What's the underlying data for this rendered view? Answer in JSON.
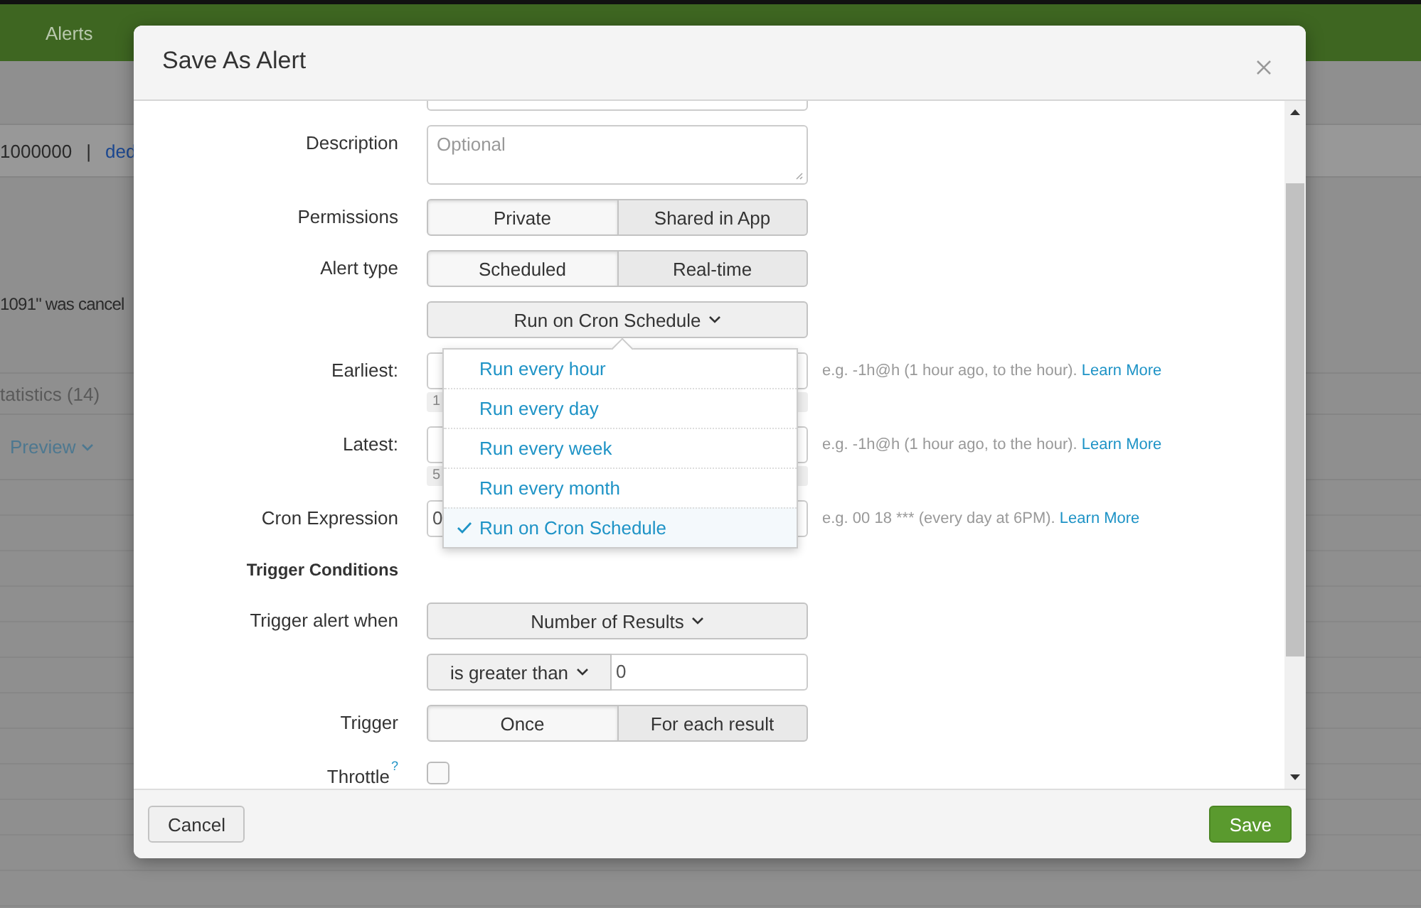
{
  "background": {
    "nav": [
      {
        "label": "Alerts"
      }
    ],
    "summary": {
      "count": "1000000",
      "separator": "|",
      "link": "ded"
    },
    "message": "1091\" was cancel",
    "tab": "tatistics (14)",
    "preview": "Preview"
  },
  "dialog": {
    "title": "Save As Alert",
    "rows": [
      {
        "kind": "textarea",
        "label": "Description",
        "placeholder": "Optional"
      },
      {
        "kind": "segmented",
        "label": "Permissions",
        "options": [
          {
            "label": "Private",
            "selected": true
          },
          {
            "label": "Shared in App",
            "selected": false
          }
        ]
      },
      {
        "kind": "segmented",
        "label": "Alert type",
        "options": [
          {
            "label": "Scheduled",
            "selected": true
          },
          {
            "label": "Real-time",
            "selected": false
          }
        ]
      },
      {
        "kind": "dropdown",
        "label": "",
        "value": "Run on Cron Schedule",
        "expanded": true,
        "options": [
          {
            "label": "Run every hour",
            "selected": false
          },
          {
            "label": "Run every day",
            "selected": false
          },
          {
            "label": "Run every week",
            "selected": false
          },
          {
            "label": "Run every month",
            "selected": false
          },
          {
            "label": "Run on Cron Schedule",
            "selected": true
          }
        ]
      },
      {
        "kind": "time",
        "label": "Earliest:",
        "note": "1",
        "help": "e.g. -1h@h (1 hour ago, to the hour).",
        "link": "Learn More"
      },
      {
        "kind": "time",
        "label": "Latest:",
        "note": "5",
        "help": "e.g. -1h@h (1 hour ago, to the hour).",
        "link": "Learn More"
      },
      {
        "kind": "text",
        "label": "Cron Expression",
        "value": "0",
        "help": "e.g. 00 18 *** (every day at 6PM).",
        "link": "Learn More"
      },
      {
        "kind": "heading",
        "label": "Trigger Conditions"
      },
      {
        "kind": "dropdown",
        "label": "Trigger alert when",
        "value": "Number of Results",
        "expanded": false
      },
      {
        "kind": "compare",
        "label": "",
        "operator": "is greater than",
        "value": "0"
      },
      {
        "kind": "segmented",
        "label": "Trigger",
        "options": [
          {
            "label": "Once",
            "selected": true
          },
          {
            "label": "For each result",
            "selected": false
          }
        ]
      },
      {
        "kind": "checkbox",
        "label": "Throttle",
        "mark": "?",
        "checked": false
      }
    ],
    "buttons": {
      "cancel": "Cancel",
      "save": "Save"
    }
  }
}
